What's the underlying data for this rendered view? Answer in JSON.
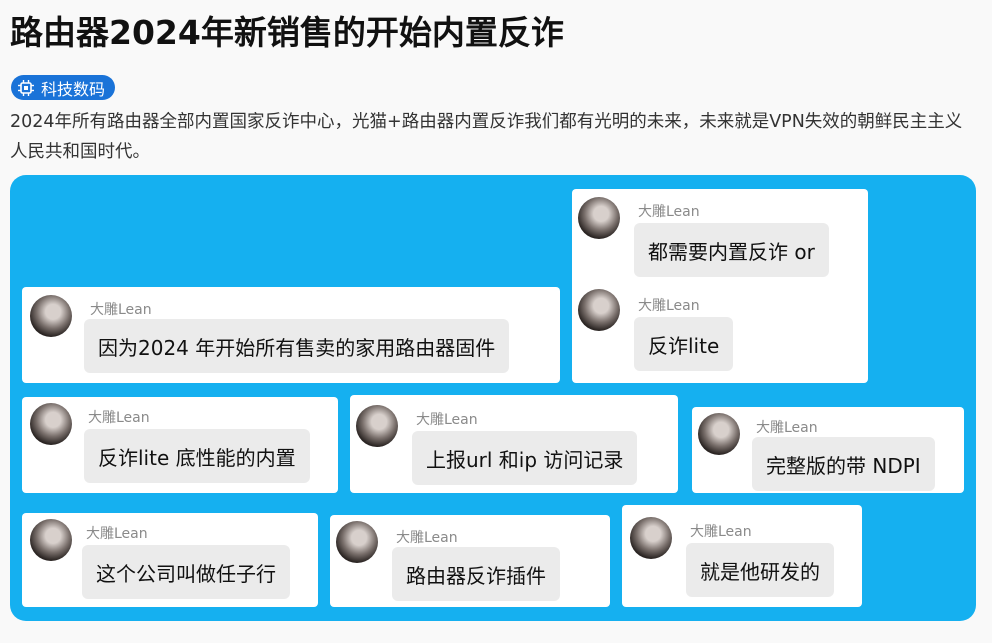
{
  "article": {
    "title": "路由器2024年新销售的开始内置反诈",
    "tag_label": "科技数码",
    "summary": "2024年所有路由器全部内置国家反诈中心，光猫+路由器内置反诈我们都有光明的未来，未来就是VPN失效的朝鲜民主主义人民共和国时代。"
  },
  "colors": {
    "accent": "#1a73d8",
    "figure_bg": "#15b0f0"
  },
  "messages": [
    {
      "user": "大雕Lean",
      "text": "因为2024 年开始所有售卖的家用路由器固件"
    },
    {
      "user": "大雕Lean",
      "text": "都需要内置反诈 or"
    },
    {
      "user": "大雕Lean",
      "text": "反诈lite"
    },
    {
      "user": "大雕Lean",
      "text": "反诈lite 底性能的内置"
    },
    {
      "user": "大雕Lean",
      "text": "上报url 和ip 访问记录"
    },
    {
      "user": "大雕Lean",
      "text": "完整版的带 NDPI"
    },
    {
      "user": "大雕Lean",
      "text": "这个公司叫做任子行"
    },
    {
      "user": "大雕Lean",
      "text": "路由器反诈插件"
    },
    {
      "user": "大雕Lean",
      "text": "就是他研发的"
    }
  ]
}
